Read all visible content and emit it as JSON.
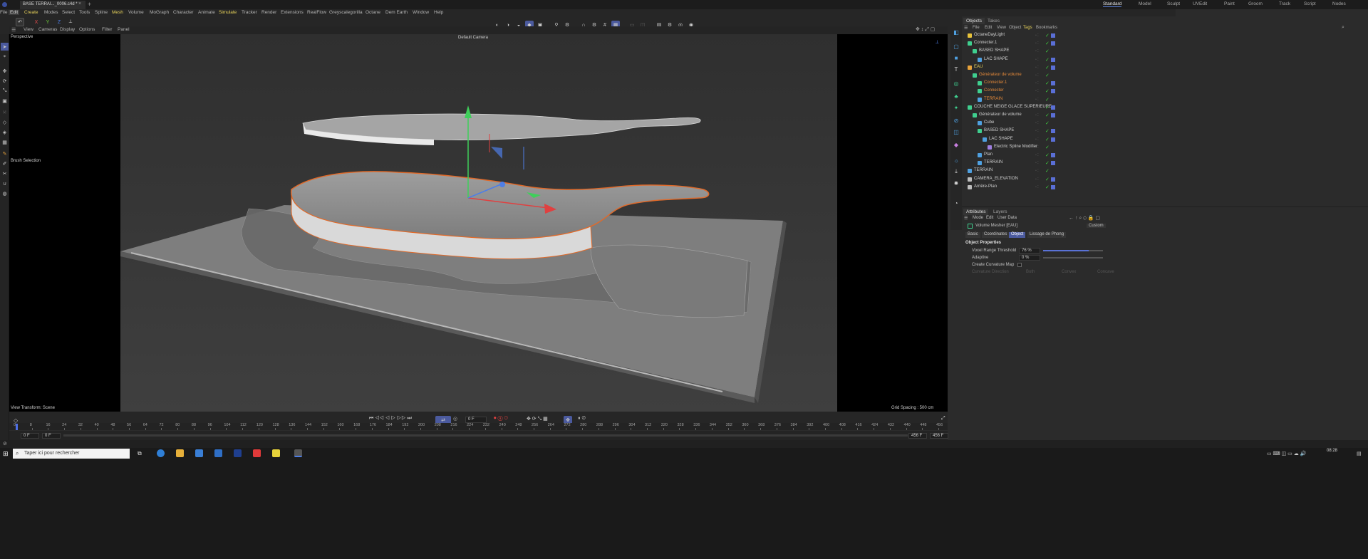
{
  "document": {
    "tab_label": "BASE TERRAI..._0006.c4d *",
    "close": "×",
    "add": "+"
  },
  "layouts": [
    "Standard",
    "Model",
    "Sculpt",
    "UVEdit",
    "Paint",
    "Groom",
    "Track",
    "Script",
    "Nodes"
  ],
  "menu": [
    "File",
    "Edit",
    "Create",
    "Modes",
    "Select",
    "Tools",
    "Spline",
    "Mesh",
    "Volume",
    "MoGraph",
    "Character",
    "Animate",
    "Simulate",
    "Tracker",
    "Render",
    "Extensions",
    "RealFlow",
    "Greyscalegorilla",
    "Octane",
    "Dem Earth",
    "Window",
    "Help"
  ],
  "toolbar": {
    "x": "X",
    "y": "Y",
    "z": "Z"
  },
  "viewport": {
    "menu": [
      "View",
      "Cameras",
      "Display",
      "Options",
      "Filter",
      "Panel"
    ],
    "view_name": "Perspective",
    "camera": "Default Camera",
    "brush_selection": "Brush Selection",
    "view_transform": "View Transform: Scene",
    "grid_spacing": "Grid Spacing : 500 cm"
  },
  "objects_panel": {
    "tabs": [
      "Objects",
      "Takes"
    ],
    "menu": [
      "File",
      "Edit",
      "View",
      "Object",
      "Tags",
      "Bookmarks"
    ],
    "rows": [
      {
        "name": "OctaneDayLight",
        "indent": 0,
        "color": "white",
        "icon": "#e7c23a"
      },
      {
        "name": "Connecter.1",
        "indent": 0,
        "color": "white",
        "icon": "#3fcf8f"
      },
      {
        "name": "BASED SHAPE",
        "indent": 1,
        "color": "white",
        "icon": "#3fcf8f"
      },
      {
        "name": "LAC SHAPE",
        "indent": 2,
        "color": "white",
        "icon": "#4fa0e0"
      },
      {
        "name": "EAU",
        "indent": 0,
        "color": "yellow",
        "icon": "#e7a23a"
      },
      {
        "name": "Générateur de volume",
        "indent": 1,
        "color": "orange",
        "icon": "#3fcf8f"
      },
      {
        "name": "Connecter.1",
        "indent": 2,
        "color": "orange",
        "icon": "#3fcf8f"
      },
      {
        "name": "Connecter",
        "indent": 2,
        "color": "orange",
        "icon": "#3fcf8f"
      },
      {
        "name": "TERRAIN",
        "indent": 2,
        "color": "orange",
        "icon": "#4fa0e0"
      },
      {
        "name": "COUCHE NEIGE GLACE SUPERIEURE",
        "indent": 0,
        "color": "white",
        "icon": "#3fcf8f"
      },
      {
        "name": "Générateur de volume",
        "indent": 1,
        "color": "white",
        "icon": "#3fcf8f"
      },
      {
        "name": "Cube",
        "indent": 2,
        "color": "white",
        "icon": "#4fa0e0"
      },
      {
        "name": "BASED SHAPE",
        "indent": 2,
        "color": "white",
        "icon": "#3fcf8f"
      },
      {
        "name": "LAC SHAPE",
        "indent": 3,
        "color": "white",
        "icon": "#4fa0e0"
      },
      {
        "name": "Electric Spline Modifier",
        "indent": 4,
        "color": "white",
        "icon": "#9f7fe0"
      },
      {
        "name": "Plan",
        "indent": 2,
        "color": "white",
        "icon": "#4fa0e0"
      },
      {
        "name": "TERRAIN",
        "indent": 2,
        "color": "white",
        "icon": "#4fa0e0"
      },
      {
        "name": "TERRAIN",
        "indent": 0,
        "color": "white",
        "icon": "#4fa0e0"
      },
      {
        "name": "CAMERA_ELEVATION",
        "indent": 0,
        "color": "white",
        "icon": "#bdbdbd"
      },
      {
        "name": "Arrière-Plan",
        "indent": 0,
        "color": "white",
        "icon": "#bdbdbd"
      }
    ]
  },
  "attributes_panel": {
    "tabs": [
      "Attributes",
      "Layers"
    ],
    "menu": [
      "Mode",
      "Edit",
      "User Data"
    ],
    "object_title": "Volume Mesher [EAU]",
    "preset": "Custom",
    "sub_tabs": [
      "Basic",
      "Coordinates",
      "Object",
      "Lissage de Phong"
    ],
    "active_sub_tab": "Object",
    "section": "Object Properties",
    "voxel_label": "Voxel Range Threshold",
    "voxel_value": "76 %",
    "voxel_fraction": 0.76,
    "adaptive_label": "Adaptive",
    "adaptive_value": "0 %",
    "curvature_map_label": "Create Curvature Map",
    "curvature_dir_label": "Curvature Direction",
    "curvature_options": [
      "Both",
      "Convex",
      "Concave"
    ]
  },
  "timeline": {
    "current_frame": "0 F",
    "start": "0 F",
    "start2": "0 F",
    "end": "456 F",
    "end2": "456 F",
    "ticks": [
      0,
      8,
      16,
      24,
      32,
      40,
      48,
      56,
      64,
      72,
      80,
      88,
      96,
      104,
      112,
      120,
      128,
      136,
      144,
      152,
      160,
      168,
      176,
      184,
      192,
      200,
      208,
      216,
      224,
      232,
      240,
      248,
      256,
      264,
      272,
      280,
      288,
      296,
      304,
      312,
      320,
      328,
      336,
      344,
      352,
      360,
      368,
      376,
      384,
      392,
      400,
      408,
      416,
      424,
      432,
      440,
      448,
      456
    ]
  },
  "taskbar": {
    "search_placeholder": "Taper ici pour rechercher",
    "time": "08:28"
  }
}
